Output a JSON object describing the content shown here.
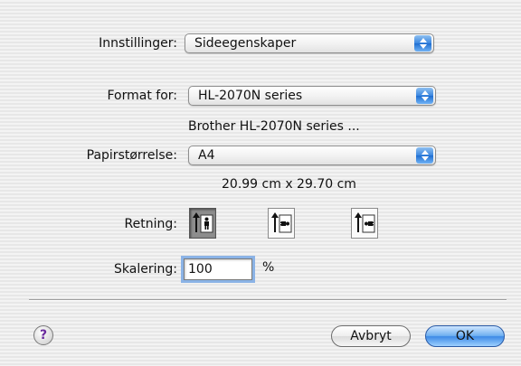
{
  "settings": {
    "label": "Innstillinger:",
    "value": "Sideegenskaper"
  },
  "format_for": {
    "label": "Format for:",
    "value": "HL-2070N series",
    "description": "Brother HL-2070N series ..."
  },
  "paper_size": {
    "label": "Papirstørrelse:",
    "value": "A4",
    "dimensions": "20.99 cm x 29.70 cm"
  },
  "orientation": {
    "label": "Retning:",
    "options": [
      {
        "name": "portrait",
        "icon": "portrait-icon",
        "selected": true
      },
      {
        "name": "landscape",
        "icon": "landscape-icon",
        "selected": false
      },
      {
        "name": "reverse-landscape",
        "icon": "reverse-landscape-icon",
        "selected": false
      }
    ]
  },
  "scale": {
    "label": "Skalering:",
    "value": "100",
    "unit": "%"
  },
  "buttons": {
    "help": "?",
    "cancel": "Avbryt",
    "ok": "OK"
  },
  "colors": {
    "accent": "#3d8ae6",
    "help_glyph": "#6b2c9e",
    "focus_ring": "#8bb3e6"
  }
}
